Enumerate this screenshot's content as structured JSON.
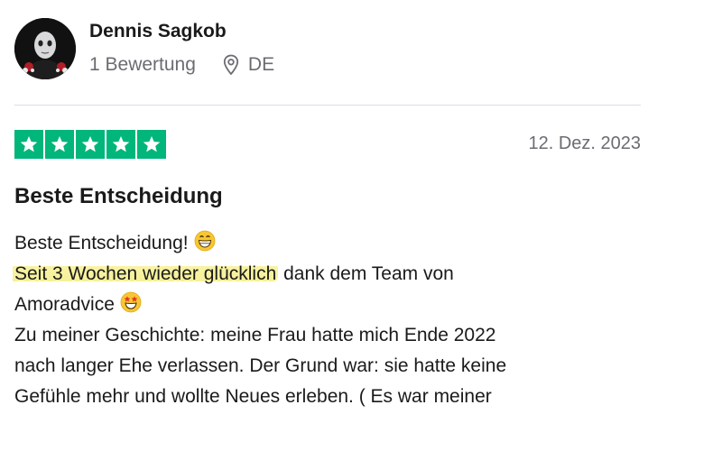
{
  "author": {
    "name": "Dennis Sagkob",
    "review_count": "1 Bewertung",
    "country": "DE",
    "avatar_icon": "person-avatar-icon",
    "location_icon": "location-pin-icon"
  },
  "review": {
    "rating": 5,
    "max_rating": 5,
    "star_color": "#00b67a",
    "date": "12. Dez. 2023",
    "title": "Beste Entscheidung",
    "body": {
      "line1": "Beste Entscheidung!",
      "line1_emoji": "grinning-face-emoji",
      "line2_highlighted": "Seit 3 Wochen wieder glücklich",
      "line2_rest": " dank dem Team von",
      "line3": "Amoradvice",
      "line3_emoji": "star-struck-emoji",
      "line4": "Zu meiner Geschichte: meine Frau hatte mich Ende 2022",
      "line5": "nach langer Ehe verlassen. Der Grund war: sie hatte keine",
      "line6": "Gefühle mehr und wollte Neues erleben. ( Es war meiner"
    },
    "highlight_color": "#f6f09a"
  }
}
